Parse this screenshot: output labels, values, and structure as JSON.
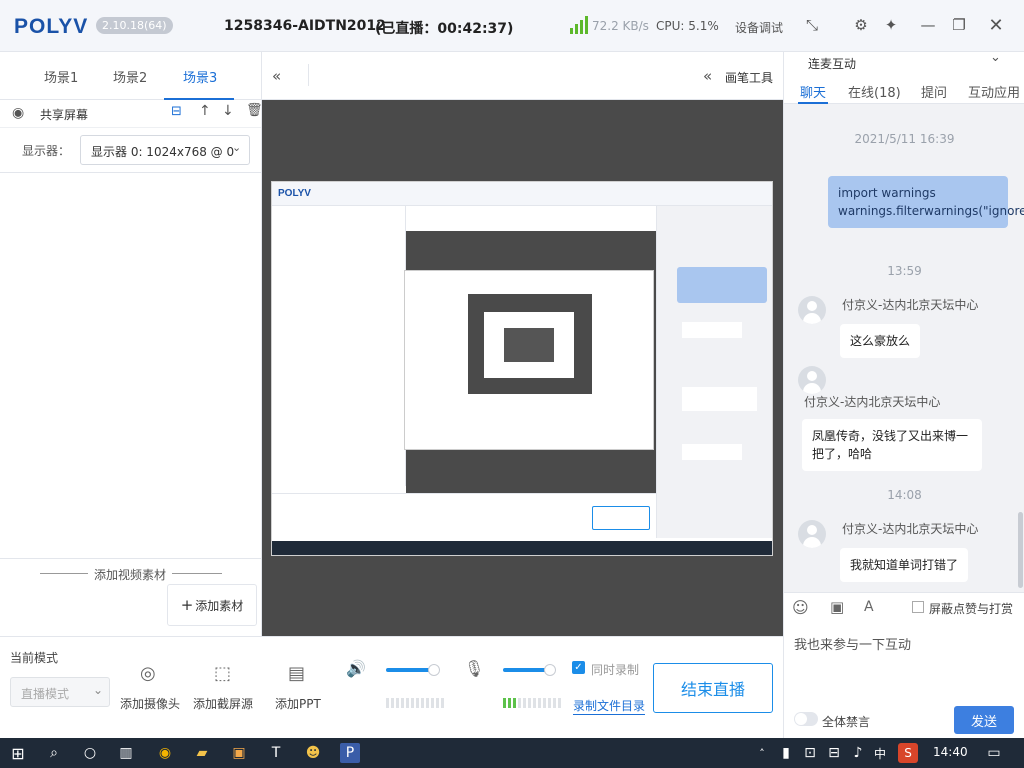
{
  "app": {
    "logo": "POLYV",
    "version": "2.10.18(64)",
    "room_id": "1258346-AIDTN2012",
    "live_status": "(已直播：00:42:37)",
    "net_speed": "72.2 KB/s",
    "cpu": "CPU: 5.1%",
    "device_debug": "设备调试",
    "colors": {
      "accent": "#1b6fd6",
      "live_blue": "#1b8de8",
      "signal_green": "#5cb82a"
    }
  },
  "scenes": {
    "tabs": [
      "场景1",
      "场景2",
      "场景3"
    ],
    "active": "场景3",
    "source_name": "共享屏幕",
    "display_label": "显示器：",
    "display_value": "显示器 0: 1024x768 @ 0"
  },
  "video_material": {
    "label": "添加视频素材",
    "add_button": "添加素材"
  },
  "center": {
    "pen_tool": "画笔工具"
  },
  "chat": {
    "header": "连麦互动",
    "tabs": [
      "聊天",
      "在线(18)",
      "提问",
      "互动应用"
    ],
    "messages": [
      {
        "type": "time",
        "text": "2021/5/11 16:39"
      },
      {
        "type": "me",
        "text": "import warnings warnings.filterwarnings(\"ignore\")"
      },
      {
        "type": "time",
        "text": "13:59"
      },
      {
        "type": "other",
        "user": "付京义-达内北京天坛中心",
        "text": "这么豪放么"
      },
      {
        "type": "other",
        "user": "付京义-达内北京天坛中心",
        "text": "凤凰传奇，没钱了又出来博一把了，哈哈"
      },
      {
        "type": "time",
        "text": "14:08"
      },
      {
        "type": "other",
        "user": "付京义-达内北京天坛中心",
        "text": "我就知道单词打错了"
      }
    ],
    "block_likes": "屏蔽点赞与打赏",
    "input_placeholder": "我也来参与一下互动",
    "mute_all": "全体禁言",
    "send": "发送"
  },
  "bottom": {
    "mode_label": "当前模式",
    "mode_value": "直播模式",
    "add_camera": "添加摄像头",
    "add_capture": "添加截屏源",
    "add_ppt": "添加PPT",
    "sync_record": "同时录制",
    "record_dir": "录制文件目录",
    "end_live": "结束直播",
    "speaker_level": 0.85,
    "mic_level": 0.85
  },
  "taskbar": {
    "time": "14:40",
    "ime": "中"
  }
}
